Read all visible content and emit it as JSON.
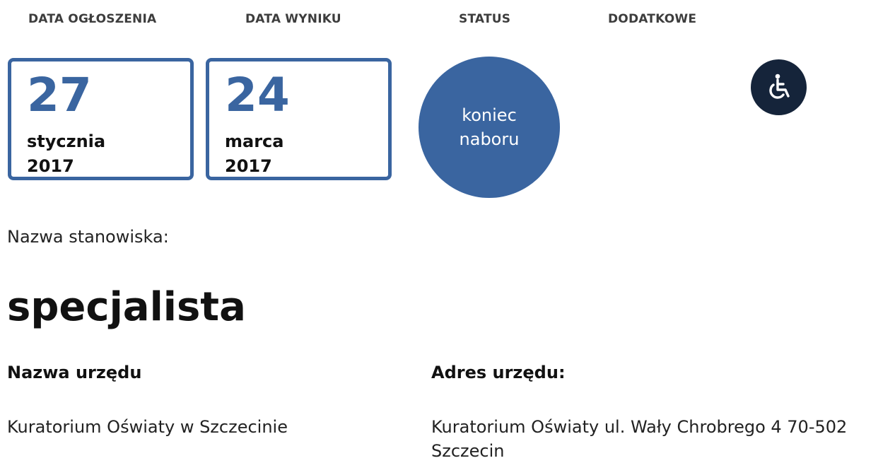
{
  "headers": {
    "announcement_date": "DATA OGŁOSZENIA",
    "result_date": "DATA WYNIKU",
    "status": "STATUS",
    "additional": "DODATKOWE"
  },
  "announcement_date": {
    "day": "27",
    "month": "stycznia",
    "year": "2017"
  },
  "result_date": {
    "day": "24",
    "month": "marca",
    "year": "2017"
  },
  "status": {
    "line1": "koniec",
    "line2": "naboru"
  },
  "additional": {
    "icon": "wheelchair-icon"
  },
  "position": {
    "label": "Nazwa stanowiska:",
    "title": "specjalista"
  },
  "office": {
    "name_label": "Nazwa urzędu",
    "name_value": "Kuratorium Oświaty w Szczecinie",
    "address_label": "Adres urzędu:",
    "address_value": "Kuratorium Oświaty ul. Wały Chrobrego 4 70-502 Szczecin"
  },
  "colors": {
    "accent": "#3a65a0",
    "icon_background": "#15243a",
    "text": "#111111"
  }
}
